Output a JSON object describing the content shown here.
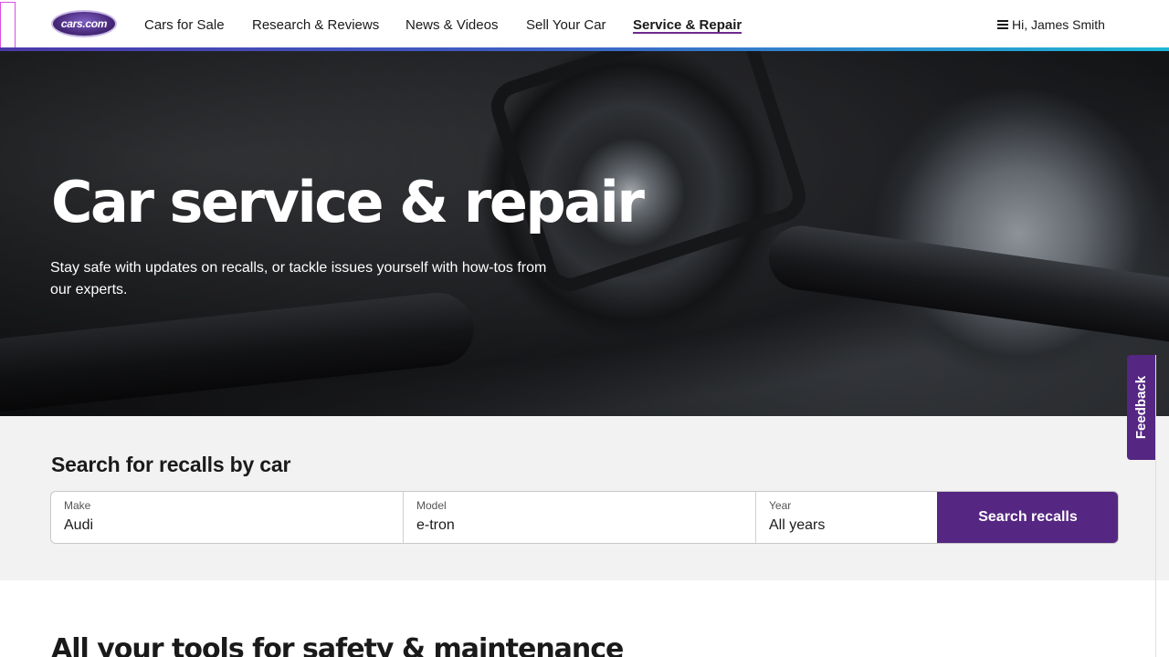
{
  "header": {
    "logo_text": "cars.com",
    "nav": [
      {
        "label": "Cars for Sale",
        "active": false
      },
      {
        "label": "Research & Reviews",
        "active": false
      },
      {
        "label": "News & Videos",
        "active": false
      },
      {
        "label": "Sell Your Car",
        "active": false
      },
      {
        "label": "Service & Repair",
        "active": true
      }
    ],
    "user_greeting": "Hi, James Smith"
  },
  "hero": {
    "title": "Car service & repair",
    "subtitle": "Stay safe with updates on recalls, or tackle issues yourself with how-tos from our experts."
  },
  "recall_search": {
    "heading": "Search for recalls by car",
    "make": {
      "label": "Make",
      "value": "Audi"
    },
    "model": {
      "label": "Model",
      "value": "e-tron"
    },
    "year": {
      "label": "Year",
      "value": "All years"
    },
    "button_label": "Search recalls"
  },
  "tools": {
    "heading": "All your tools for safety & maintenance"
  },
  "feedback": {
    "label": "Feedback"
  },
  "colors": {
    "brand_purple": "#552682",
    "nav_gradient_start": "#4b3aa8",
    "nav_gradient_end": "#1fb6d6",
    "section_bg": "#f2f2f2"
  }
}
